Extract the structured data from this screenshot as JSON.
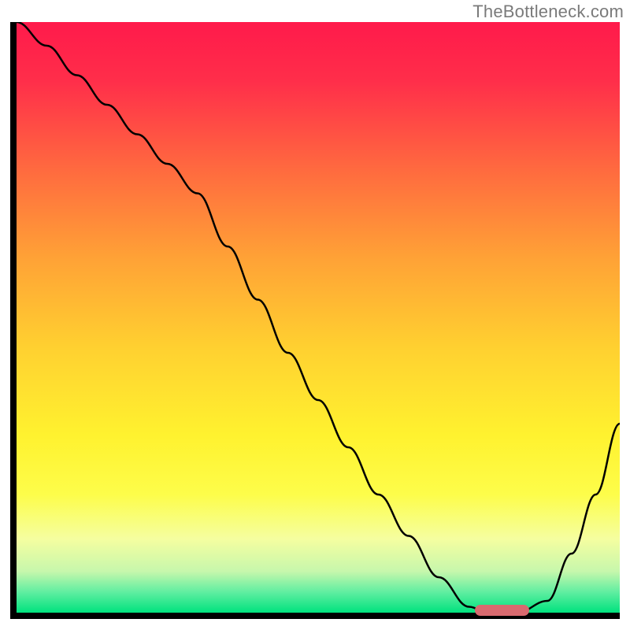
{
  "watermark": "TheBottleneck.com",
  "chart_data": {
    "type": "line",
    "title": "",
    "xlabel": "",
    "ylabel": "",
    "xlim": [
      0,
      100
    ],
    "ylim": [
      0,
      100
    ],
    "grid": false,
    "legend": false,
    "background_gradient": {
      "stops": [
        {
          "offset": 0.0,
          "color": "#ff1a4b"
        },
        {
          "offset": 0.1,
          "color": "#ff2e4a"
        },
        {
          "offset": 0.25,
          "color": "#ff6a3f"
        },
        {
          "offset": 0.4,
          "color": "#ffa236"
        },
        {
          "offset": 0.55,
          "color": "#ffd030"
        },
        {
          "offset": 0.7,
          "color": "#fff22f"
        },
        {
          "offset": 0.8,
          "color": "#fdfd4a"
        },
        {
          "offset": 0.875,
          "color": "#f5fea0"
        },
        {
          "offset": 0.93,
          "color": "#c7f7ac"
        },
        {
          "offset": 0.965,
          "color": "#60eea1"
        },
        {
          "offset": 1.0,
          "color": "#00e27e"
        }
      ]
    },
    "series": [
      {
        "name": "curve",
        "x": [
          0,
          5,
          10,
          15,
          20,
          25,
          30,
          35,
          40,
          45,
          50,
          55,
          60,
          65,
          70,
          75,
          78,
          83,
          88,
          92,
          96,
          100
        ],
        "y": [
          100,
          96,
          91,
          86,
          81,
          76,
          71,
          62,
          53,
          44,
          36,
          28,
          20,
          13,
          6,
          1,
          0,
          0,
          2,
          10,
          20,
          32
        ]
      }
    ],
    "marker": {
      "x_start": 76,
      "x_end": 85,
      "y": 0
    },
    "annotations": []
  }
}
